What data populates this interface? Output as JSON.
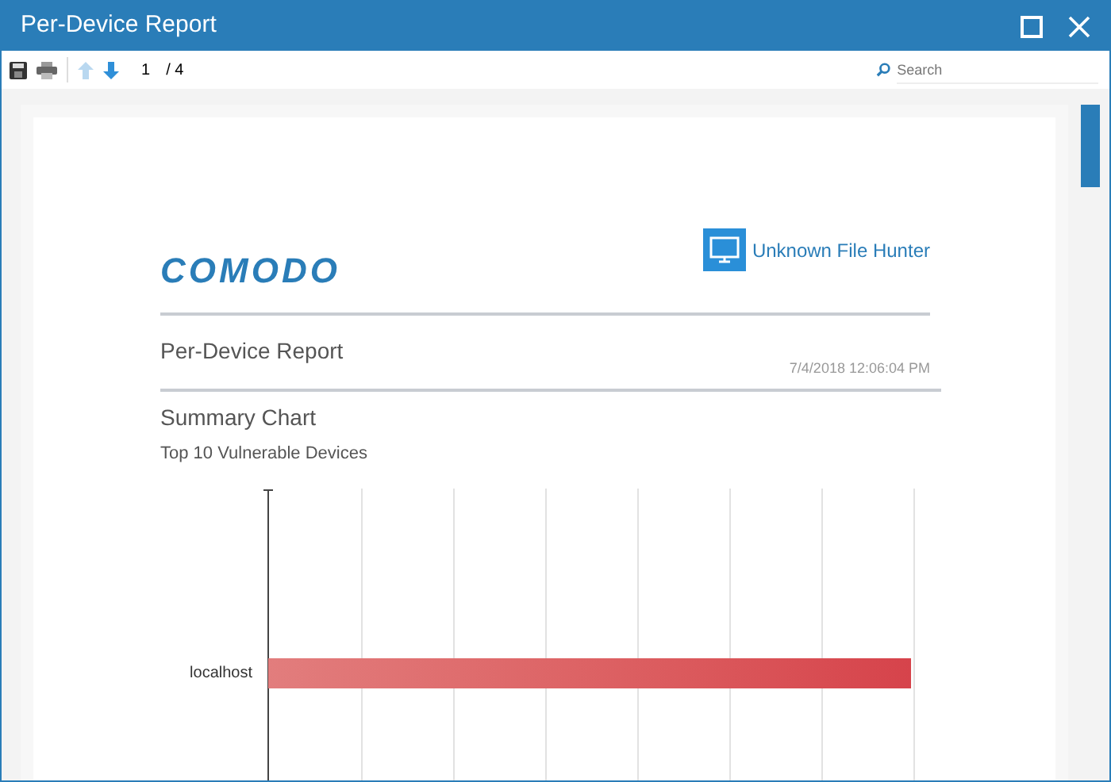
{
  "window": {
    "title": "Per-Device Report"
  },
  "toolbar": {
    "page": "1",
    "page_total": "/ 4",
    "search": {
      "placeholder": "Search"
    }
  },
  "report": {
    "logo": "COMODO",
    "product": "Unknown File Hunter",
    "title": "Per-Device Report",
    "date": "7/4/2018 12:06:04 PM",
    "section": "Summary Chart",
    "subtitle": "Top 10 Vulnerable Devices",
    "chart": {
      "bars": [
        {
          "label": "localhost"
        }
      ]
    }
  }
}
